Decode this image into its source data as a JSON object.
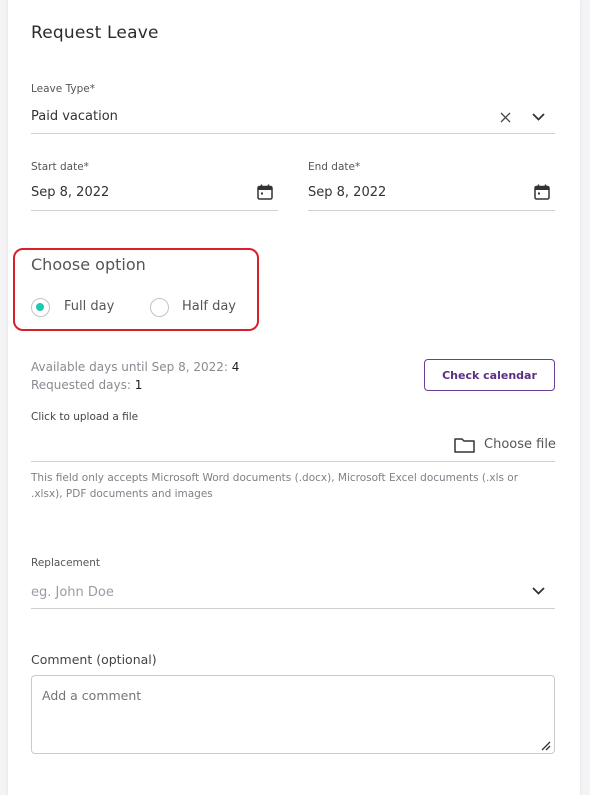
{
  "form": {
    "title": "Request Leave",
    "leave_type": {
      "label": "Leave Type",
      "required_mark": "*",
      "value": "Paid vacation"
    },
    "start_date": {
      "label": "Start date",
      "required_mark": "*",
      "value": "Sep 8, 2022"
    },
    "end_date": {
      "label": "End date",
      "required_mark": "*",
      "value": "Sep 8, 2022"
    },
    "choose_option": {
      "title": "Choose option",
      "options": [
        {
          "label": "Full day",
          "selected": true
        },
        {
          "label": "Half day",
          "selected": false
        }
      ]
    },
    "availability": {
      "available_label": "Available days until Sep 8, 2022:",
      "available_value": "4",
      "requested_label": "Requested days:",
      "requested_value": "1",
      "check_calendar_label": "Check calendar"
    },
    "upload": {
      "label": "Click to upload a file",
      "choose_file_label": "Choose file",
      "help_text": "This field only accepts Microsoft Word documents (.docx), Microsoft Excel documents (.xls or .xlsx), PDF documents and images"
    },
    "replacement": {
      "label": "Replacement",
      "placeholder": "eg. John Doe"
    },
    "comment": {
      "label": "Comment (optional)",
      "placeholder": "Add a comment"
    }
  },
  "colors": {
    "accent_teal": "#1fc7b4",
    "button_purple": "#5b2f82",
    "highlight_red": "#d9202a"
  },
  "icons": {
    "clear": "close-icon",
    "dropdown": "chevron-down-icon",
    "date": "calendar-icon",
    "upload": "folder-icon",
    "resize": "resize-handle-icon"
  }
}
